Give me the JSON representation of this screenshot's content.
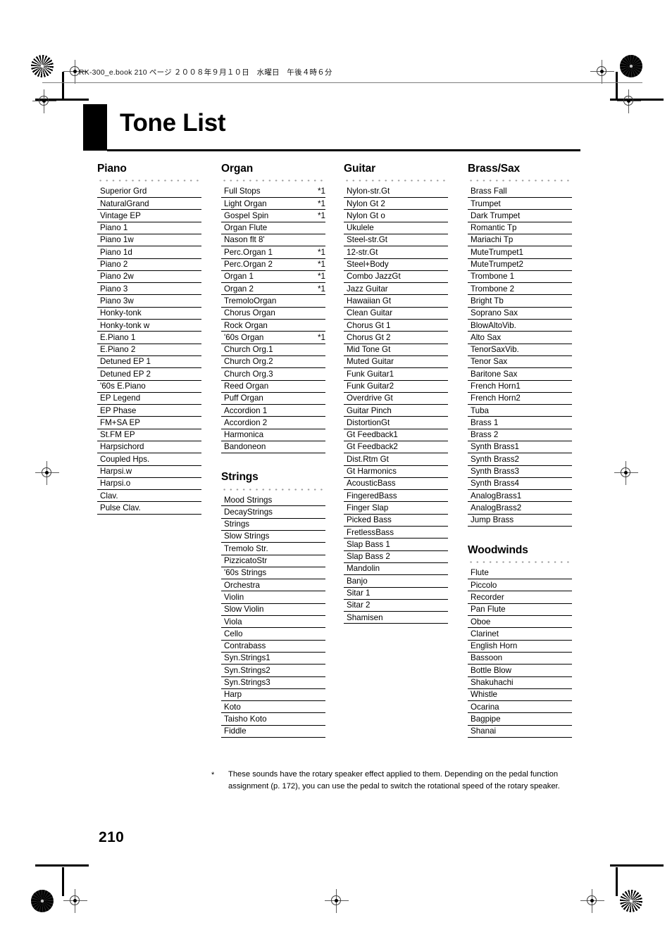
{
  "document": {
    "header_line": "RK-300_e.book  210 ページ  ２００８年９月１０日　水曜日　午後４時６分",
    "title": "Tone List",
    "page_number": "210",
    "footnote_mark": "*",
    "footnote_text": "These sounds have the rotary speaker effect applied to them. Depending on the pedal function assignment (p. 172), you can use the pedal to switch the rotational speed of the rotary speaker."
  },
  "columns": [
    {
      "sections": [
        {
          "title": "Piano",
          "rows": [
            {
              "name": "Superior Grd",
              "note": ""
            },
            {
              "name": "NaturalGrand",
              "note": ""
            },
            {
              "name": "Vintage EP",
              "note": ""
            },
            {
              "name": "Piano 1",
              "note": ""
            },
            {
              "name": "Piano 1w",
              "note": ""
            },
            {
              "name": "Piano 1d",
              "note": ""
            },
            {
              "name": "Piano 2",
              "note": ""
            },
            {
              "name": "Piano 2w",
              "note": ""
            },
            {
              "name": "Piano 3",
              "note": ""
            },
            {
              "name": "Piano 3w",
              "note": ""
            },
            {
              "name": "Honky-tonk",
              "note": ""
            },
            {
              "name": "Honky-tonk w",
              "note": ""
            },
            {
              "name": "E.Piano 1",
              "note": ""
            },
            {
              "name": "E.Piano 2",
              "note": ""
            },
            {
              "name": "Detuned EP 1",
              "note": ""
            },
            {
              "name": "Detuned EP 2",
              "note": ""
            },
            {
              "name": "'60s E.Piano",
              "note": ""
            },
            {
              "name": "EP Legend",
              "note": ""
            },
            {
              "name": "EP Phase",
              "note": ""
            },
            {
              "name": "FM+SA EP",
              "note": ""
            },
            {
              "name": "St.FM EP",
              "note": ""
            },
            {
              "name": "Harpsichord",
              "note": ""
            },
            {
              "name": "Coupled Hps.",
              "note": ""
            },
            {
              "name": "Harpsi.w",
              "note": ""
            },
            {
              "name": "Harpsi.o",
              "note": ""
            },
            {
              "name": "Clav.",
              "note": ""
            },
            {
              "name": "Pulse Clav.",
              "note": ""
            }
          ]
        }
      ]
    },
    {
      "sections": [
        {
          "title": "Organ",
          "rows": [
            {
              "name": "Full Stops",
              "note": "*1"
            },
            {
              "name": "Light Organ",
              "note": "*1"
            },
            {
              "name": "Gospel Spin",
              "note": "*1"
            },
            {
              "name": "Organ Flute",
              "note": ""
            },
            {
              "name": "Nason flt 8'",
              "note": ""
            },
            {
              "name": "Perc.Organ 1",
              "note": "*1"
            },
            {
              "name": "Perc.Organ 2",
              "note": "*1"
            },
            {
              "name": "Organ 1",
              "note": "*1"
            },
            {
              "name": "Organ 2",
              "note": "*1"
            },
            {
              "name": "TremoloOrgan",
              "note": ""
            },
            {
              "name": "Chorus Organ",
              "note": ""
            },
            {
              "name": "Rock Organ",
              "note": ""
            },
            {
              "name": "'60s Organ",
              "note": "*1"
            },
            {
              "name": "Church Org.1",
              "note": ""
            },
            {
              "name": "Church Org.2",
              "note": ""
            },
            {
              "name": "Church Org.3",
              "note": ""
            },
            {
              "name": "Reed Organ",
              "note": ""
            },
            {
              "name": "Puff Organ",
              "note": ""
            },
            {
              "name": "Accordion 1",
              "note": ""
            },
            {
              "name": "Accordion 2",
              "note": ""
            },
            {
              "name": "Harmonica",
              "note": ""
            },
            {
              "name": "Bandoneon",
              "note": ""
            }
          ]
        },
        {
          "title": "Strings",
          "rows": [
            {
              "name": "Mood Strings",
              "note": ""
            },
            {
              "name": "DecayStrings",
              "note": ""
            },
            {
              "name": "Strings",
              "note": ""
            },
            {
              "name": "Slow Strings",
              "note": ""
            },
            {
              "name": "Tremolo Str.",
              "note": ""
            },
            {
              "name": "PizzicatoStr",
              "note": ""
            },
            {
              "name": "'60s Strings",
              "note": ""
            },
            {
              "name": "Orchestra",
              "note": ""
            },
            {
              "name": "Violin",
              "note": ""
            },
            {
              "name": "Slow Violin",
              "note": ""
            },
            {
              "name": "Viola",
              "note": ""
            },
            {
              "name": "Cello",
              "note": ""
            },
            {
              "name": "Contrabass",
              "note": ""
            },
            {
              "name": "Syn.Strings1",
              "note": ""
            },
            {
              "name": "Syn.Strings2",
              "note": ""
            },
            {
              "name": "Syn.Strings3",
              "note": ""
            },
            {
              "name": "Harp",
              "note": ""
            },
            {
              "name": "Koto",
              "note": ""
            },
            {
              "name": "Taisho Koto",
              "note": ""
            },
            {
              "name": "Fiddle",
              "note": ""
            }
          ]
        }
      ]
    },
    {
      "sections": [
        {
          "title": "Guitar",
          "rows": [
            {
              "name": "Nylon-str.Gt",
              "note": ""
            },
            {
              "name": "Nylon Gt 2",
              "note": ""
            },
            {
              "name": "Nylon Gt o",
              "note": ""
            },
            {
              "name": "Ukulele",
              "note": ""
            },
            {
              "name": "Steel-str.Gt",
              "note": ""
            },
            {
              "name": "12-str.Gt",
              "note": ""
            },
            {
              "name": "Steel+Body",
              "note": ""
            },
            {
              "name": "Combo JazzGt",
              "note": ""
            },
            {
              "name": "Jazz Guitar",
              "note": ""
            },
            {
              "name": "Hawaiian Gt",
              "note": ""
            },
            {
              "name": "Clean Guitar",
              "note": ""
            },
            {
              "name": "Chorus Gt 1",
              "note": ""
            },
            {
              "name": "Chorus Gt 2",
              "note": ""
            },
            {
              "name": "Mid Tone Gt",
              "note": ""
            },
            {
              "name": "Muted Guitar",
              "note": ""
            },
            {
              "name": "Funk Guitar1",
              "note": ""
            },
            {
              "name": "Funk Guitar2",
              "note": ""
            },
            {
              "name": "Overdrive Gt",
              "note": ""
            },
            {
              "name": "Guitar Pinch",
              "note": ""
            },
            {
              "name": "DistortionGt",
              "note": ""
            },
            {
              "name": "Gt Feedback1",
              "note": ""
            },
            {
              "name": "Gt Feedback2",
              "note": ""
            },
            {
              "name": "Dist.Rtm Gt",
              "note": ""
            },
            {
              "name": "Gt Harmonics",
              "note": ""
            },
            {
              "name": "AcousticBass",
              "note": ""
            },
            {
              "name": "FingeredBass",
              "note": ""
            },
            {
              "name": "Finger Slap",
              "note": ""
            },
            {
              "name": "Picked Bass",
              "note": ""
            },
            {
              "name": "FretlessBass",
              "note": ""
            },
            {
              "name": "Slap Bass 1",
              "note": ""
            },
            {
              "name": "Slap Bass 2",
              "note": ""
            },
            {
              "name": "Mandolin",
              "note": ""
            },
            {
              "name": "Banjo",
              "note": ""
            },
            {
              "name": "Sitar 1",
              "note": ""
            },
            {
              "name": "Sitar 2",
              "note": ""
            },
            {
              "name": "Shamisen",
              "note": ""
            }
          ]
        }
      ]
    },
    {
      "sections": [
        {
          "title": "Brass/Sax",
          "rows": [
            {
              "name": "Brass Fall",
              "note": ""
            },
            {
              "name": "Trumpet",
              "note": ""
            },
            {
              "name": "Dark Trumpet",
              "note": ""
            },
            {
              "name": "Romantic Tp",
              "note": ""
            },
            {
              "name": "Mariachi Tp",
              "note": ""
            },
            {
              "name": "MuteTrumpet1",
              "note": ""
            },
            {
              "name": "MuteTrumpet2",
              "note": ""
            },
            {
              "name": "Trombone 1",
              "note": ""
            },
            {
              "name": "Trombone 2",
              "note": ""
            },
            {
              "name": "Bright Tb",
              "note": ""
            },
            {
              "name": "Soprano Sax",
              "note": ""
            },
            {
              "name": "BlowAltoVib.",
              "note": ""
            },
            {
              "name": "Alto Sax",
              "note": ""
            },
            {
              "name": "TenorSaxVib.",
              "note": ""
            },
            {
              "name": "Tenor Sax",
              "note": ""
            },
            {
              "name": "Baritone Sax",
              "note": ""
            },
            {
              "name": "French Horn1",
              "note": ""
            },
            {
              "name": "French Horn2",
              "note": ""
            },
            {
              "name": "Tuba",
              "note": ""
            },
            {
              "name": "Brass 1",
              "note": ""
            },
            {
              "name": "Brass 2",
              "note": ""
            },
            {
              "name": "Synth Brass1",
              "note": ""
            },
            {
              "name": "Synth Brass2",
              "note": ""
            },
            {
              "name": "Synth Brass3",
              "note": ""
            },
            {
              "name": "Synth Brass4",
              "note": ""
            },
            {
              "name": "AnalogBrass1",
              "note": ""
            },
            {
              "name": "AnalogBrass2",
              "note": ""
            },
            {
              "name": "Jump Brass",
              "note": ""
            }
          ]
        },
        {
          "title": "Woodwinds",
          "rows": [
            {
              "name": "Flute",
              "note": ""
            },
            {
              "name": "Piccolo",
              "note": ""
            },
            {
              "name": "Recorder",
              "note": ""
            },
            {
              "name": "Pan Flute",
              "note": ""
            },
            {
              "name": "Oboe",
              "note": ""
            },
            {
              "name": "Clarinet",
              "note": ""
            },
            {
              "name": "English Horn",
              "note": ""
            },
            {
              "name": "Bassoon",
              "note": ""
            },
            {
              "name": "Bottle Blow",
              "note": ""
            },
            {
              "name": "Shakuhachi",
              "note": ""
            },
            {
              "name": "Whistle",
              "note": ""
            },
            {
              "name": "Ocarina",
              "note": ""
            },
            {
              "name": "Bagpipe",
              "note": ""
            },
            {
              "name": "Shanai",
              "note": ""
            }
          ]
        }
      ]
    }
  ]
}
